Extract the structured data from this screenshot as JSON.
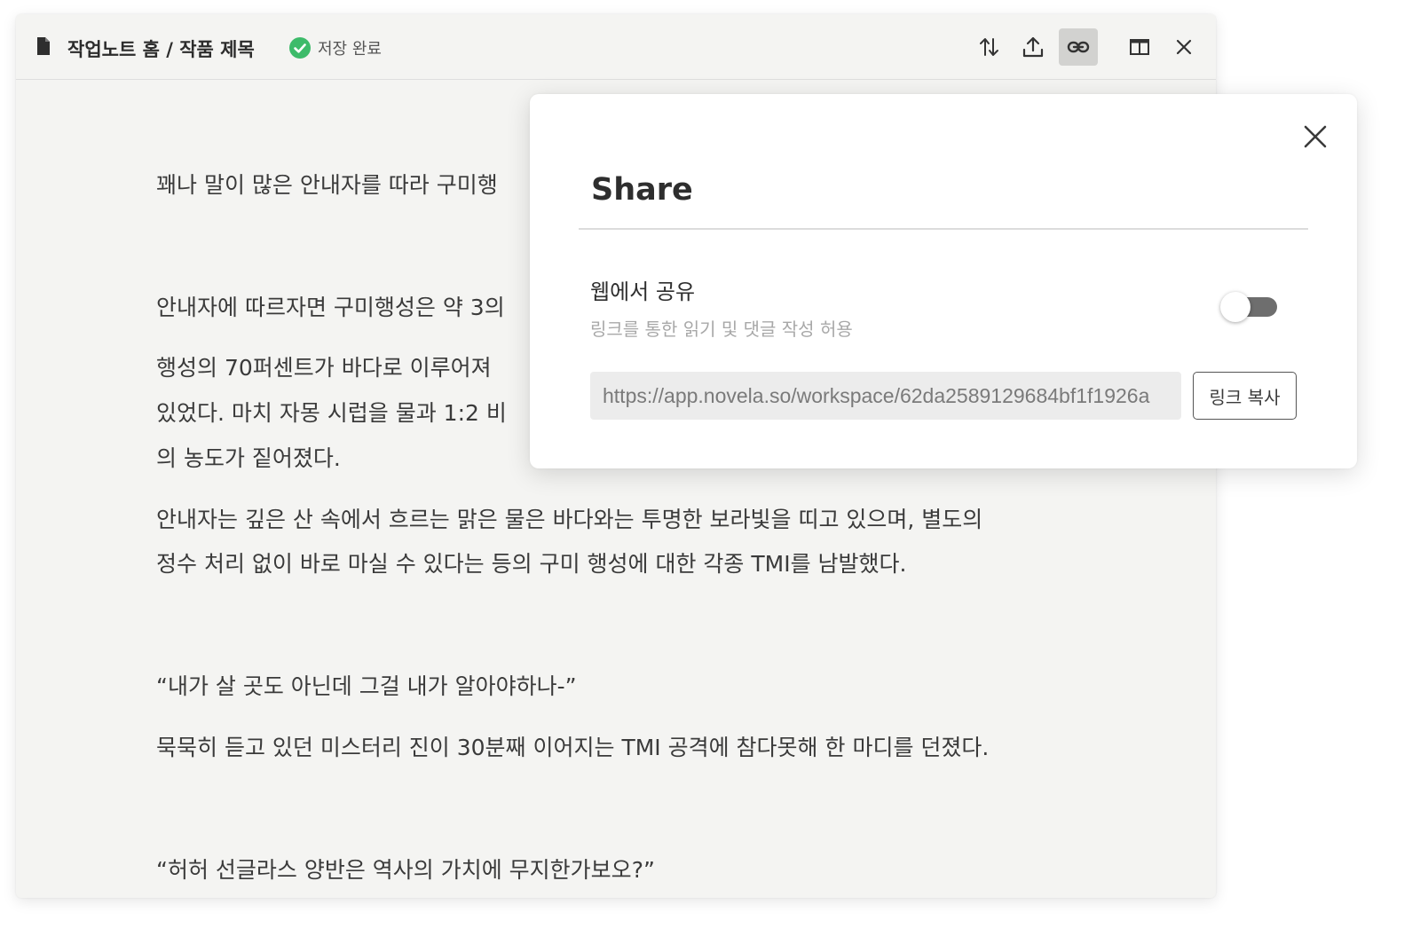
{
  "header": {
    "breadcrumb": "작업노트 홈 / 작품 제목",
    "save_status": "저장 완료",
    "toolbar_icons": [
      "sort-icon",
      "upload-icon",
      "link-icon",
      "split-view-icon",
      "close-icon"
    ],
    "active_tool": "link-icon"
  },
  "document": {
    "paragraphs": [
      "꽤나 말이 많은 안내자를 따라 구미행",
      "안내자에 따르자면 구미행성은 약 3의",
      "행성의 70퍼센트가 바다로 이루어져",
      "있었다. 마치 자몽 시럽을 물과 1:2 비",
      "의 농도가 짙어졌다.",
      "안내자는 깊은 산 속에서 흐르는 맑은 물은 바다와는 투명한 보라빛을 띠고 있으며, 별도의",
      "정수 처리 없이 바로 마실 수 있다는 등의 구미 행성에 대한 각종 TMI를 남발했다.",
      "“내가 살 곳도 아닌데 그걸 내가 알아야하나-”",
      "묵묵히 듣고 있던 미스터리 진이 30분째 이어지는 TMI 공격에 참다못해 한 마디를 던졌다.",
      "“허허 선글라스 양반은 역사의 가치에 무지한가보오?”"
    ]
  },
  "share_modal": {
    "title": "Share",
    "web_share_label": "웹에서 공유",
    "web_share_desc": "링크를 통한 읽기 및 댓글 작성 허용",
    "web_share_enabled": false,
    "url": "https://app.novela.so/workspace/62da2589129684bf1f1926a",
    "copy_button": "링크 복사"
  },
  "colors": {
    "window_bg": "#f4f4f2",
    "success_green": "#3dbb6a",
    "active_tool_bg": "#d2d2d0",
    "toggle_track": "#6e6e6e"
  }
}
